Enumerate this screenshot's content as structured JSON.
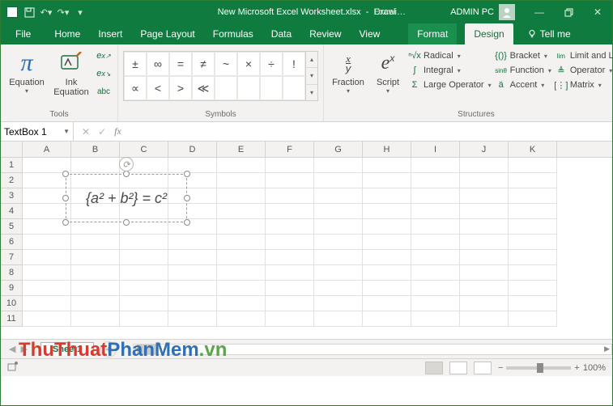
{
  "titlebar": {
    "filename": "New Microsoft Excel Worksheet.xlsx",
    "appname": "Excel",
    "context": "Drawi…",
    "username": "ADMIN PC"
  },
  "tabs": {
    "file": "File",
    "home": "Home",
    "insert": "Insert",
    "pagelayout": "Page Layout",
    "formulas": "Formulas",
    "data": "Data",
    "review": "Review",
    "view": "View",
    "format": "Format",
    "design": "Design",
    "tellme": "Tell me"
  },
  "ribbon": {
    "groups": {
      "tools": "Tools",
      "symbols": "Symbols",
      "structures": "Structures"
    },
    "equation": "Equation",
    "ink": "Ink\nEquation",
    "fraction": "Fraction",
    "script": "Script",
    "radical": "Radical",
    "integral": "Integral",
    "largeop": "Large Operator",
    "bracket": "Bracket",
    "function": "Function",
    "accent": "Accent",
    "limit": "Limit and Log",
    "operator": "Operator",
    "matrix": "Matrix",
    "symbols": [
      "±",
      "∞",
      "=",
      "≠",
      "~",
      "×",
      "÷",
      "!",
      "∝",
      "<",
      ">",
      "≪"
    ]
  },
  "formula_bar": {
    "namebox": "TextBox 1",
    "fx": "fx",
    "value": ""
  },
  "grid": {
    "cols": [
      "A",
      "B",
      "C",
      "D",
      "E",
      "F",
      "G",
      "H",
      "I",
      "J",
      "K"
    ],
    "rows": [
      "1",
      "2",
      "3",
      "4",
      "5",
      "6",
      "7",
      "8",
      "9",
      "10",
      "11"
    ]
  },
  "textbox": {
    "content": "{a² + b²} = c²"
  },
  "sheet_tab": {
    "name": "Sheet1"
  },
  "statusbar": {
    "zoom": "100%"
  },
  "watermark": {
    "p1": "ThuThuat",
    "p2": "PhanMem",
    "p3": ".vn"
  }
}
